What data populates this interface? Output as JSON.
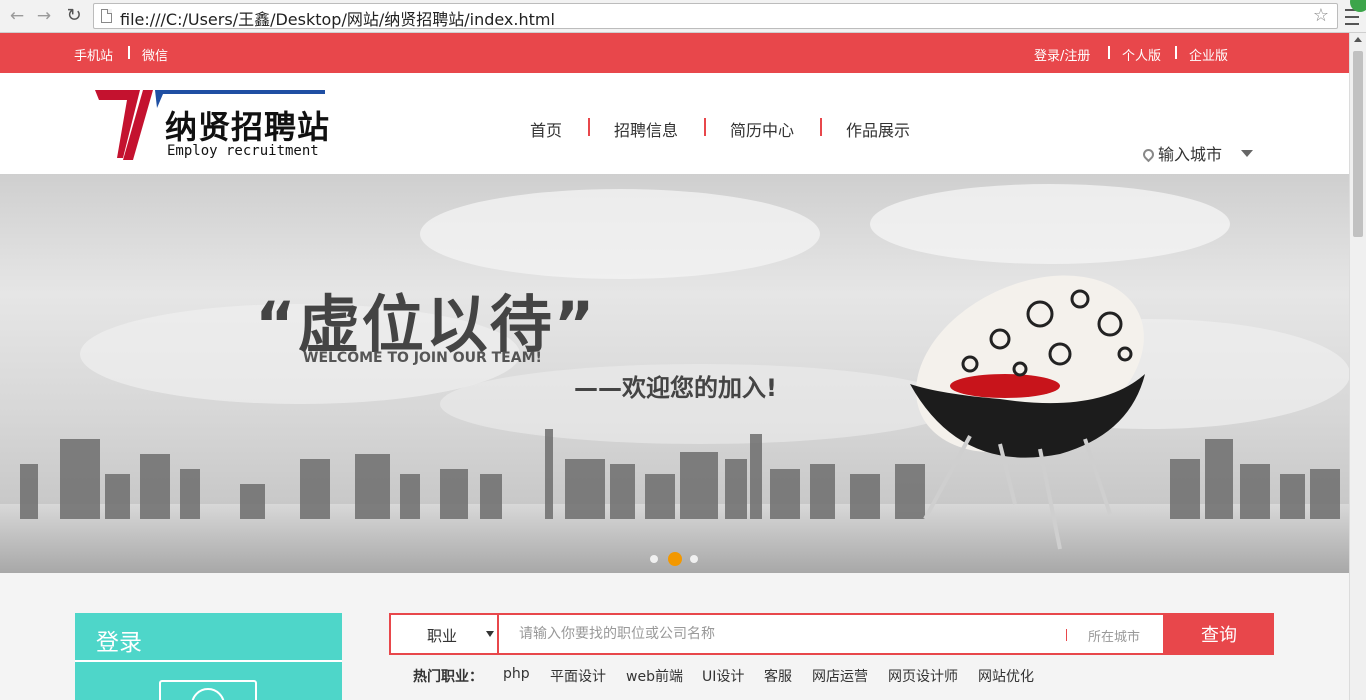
{
  "browser": {
    "url": "file:///C:/Users/王鑫/Desktop/网站/纳贤招聘站/index.html"
  },
  "topbar": {
    "left_links": [
      "手机站",
      "微信"
    ],
    "right_links": [
      "登录/注册",
      "个人版",
      "企业版"
    ]
  },
  "header": {
    "logo_cn": "纳贤招聘站",
    "logo_en": "Employ recruitment",
    "nav": [
      "首页",
      "招聘信息",
      "简历中心",
      "作品展示"
    ],
    "city_label": "输入城市"
  },
  "banner": {
    "slogan": "“虚位以待”",
    "slogan_en": "WELCOME TO JOIN OUR TEAM!",
    "subtitle": "——欢迎您的加入!",
    "slide_count": 3,
    "active_slide": 2
  },
  "login": {
    "title": "登录"
  },
  "search": {
    "category": "职业",
    "placeholder": "请输入你要找的职位或公司名称",
    "city_placeholder": "所在城市",
    "button": "查询"
  },
  "hot_jobs": {
    "label": "热门职业：",
    "items": [
      "php",
      "平面设计",
      "web前端",
      "UI设计",
      "客服",
      "网店运营",
      "网页设计师",
      "网站优化"
    ]
  },
  "colors": {
    "brand_red": "#e8474b",
    "login_teal": "#4ed6c9",
    "slide_active": "#f39800"
  }
}
